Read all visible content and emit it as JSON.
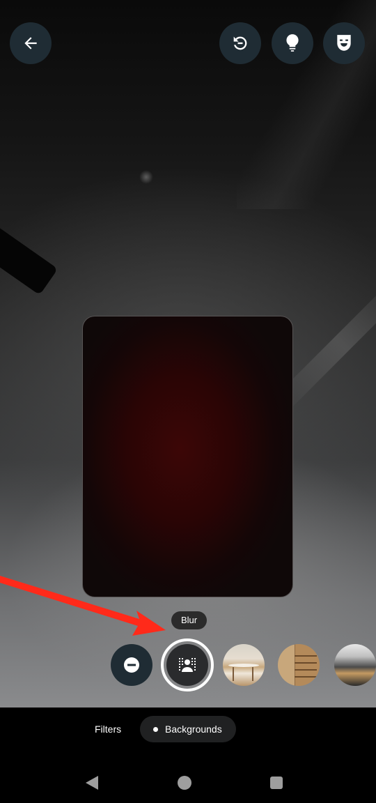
{
  "header": {
    "back_icon": "arrow-left-icon",
    "actions": [
      {
        "name": "reset",
        "icon": "reset-icon"
      },
      {
        "name": "lighting",
        "icon": "lightbulb-icon"
      },
      {
        "name": "effects",
        "icon": "theater-mask-icon"
      }
    ]
  },
  "preview": {
    "color": "#3c0606"
  },
  "annotation": {
    "arrow_color": "#ff2a1a"
  },
  "backgrounds": {
    "tooltip": "Blur",
    "items": [
      {
        "name": "none",
        "icon": "none-icon"
      },
      {
        "name": "blur",
        "icon": "blur-person-icon",
        "selected": true
      },
      {
        "name": "background-1",
        "description": "interior table thumbnail"
      },
      {
        "name": "background-2",
        "description": "bookshelf arch thumbnail"
      },
      {
        "name": "background-3",
        "description": "kitchen thumbnail"
      }
    ]
  },
  "tabs": {
    "filters": "Filters",
    "backgrounds": "Backgrounds",
    "active": "Backgrounds"
  },
  "navbar": {
    "back": "nav-back-icon",
    "home": "nav-home-icon",
    "recents": "nav-recents-icon"
  }
}
